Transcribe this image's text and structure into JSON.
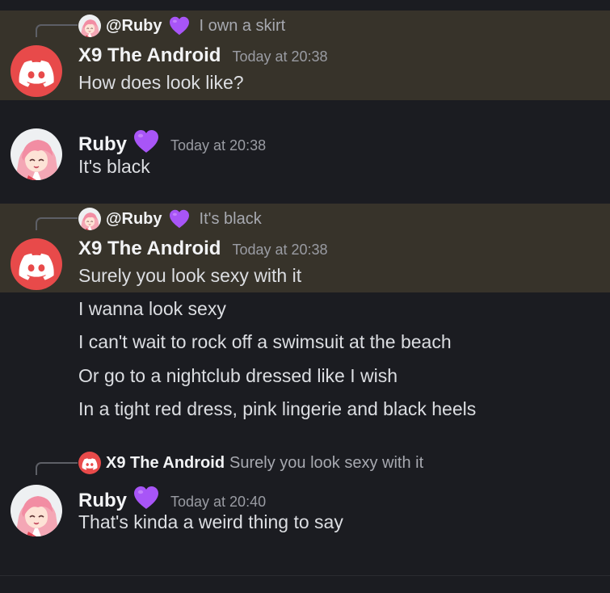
{
  "messages": [
    {
      "reply": {
        "name": "@Ruby",
        "text": "I own a skirt"
      },
      "author": "X9 The Android",
      "time": "Today at 20:38",
      "lines": [
        "How does look like?"
      ]
    },
    {
      "author": "Ruby",
      "time": "Today at 20:38",
      "lines": [
        "It's black"
      ]
    },
    {
      "reply": {
        "name": "@Ruby",
        "text": "It's black"
      },
      "author": "X9 The Android",
      "time": "Today at 20:38",
      "lines": [
        "Surely you look sexy with it",
        "I wanna look sexy",
        "I can't wait to rock off a swimsuit at the beach",
        "Or go to a nightclub dressed like I wish",
        "In a tight red dress, pink lingerie and black heels"
      ]
    },
    {
      "reply": {
        "name": "X9 The Android",
        "text": "Surely you look sexy with it"
      },
      "author": "Ruby",
      "time": "Today at 20:40",
      "lines": [
        "That's kinda a weird thing to say"
      ]
    }
  ],
  "icons": {
    "bot_avatar": "discord-logo-icon",
    "user_avatar": "anime-girl-avatar",
    "heart": "purple-heart-icon"
  },
  "colors": {
    "background": "#1b1c21",
    "highlight": "#37332a",
    "discord_red": "#e84a4a",
    "heart_purple": "#a855f7"
  }
}
